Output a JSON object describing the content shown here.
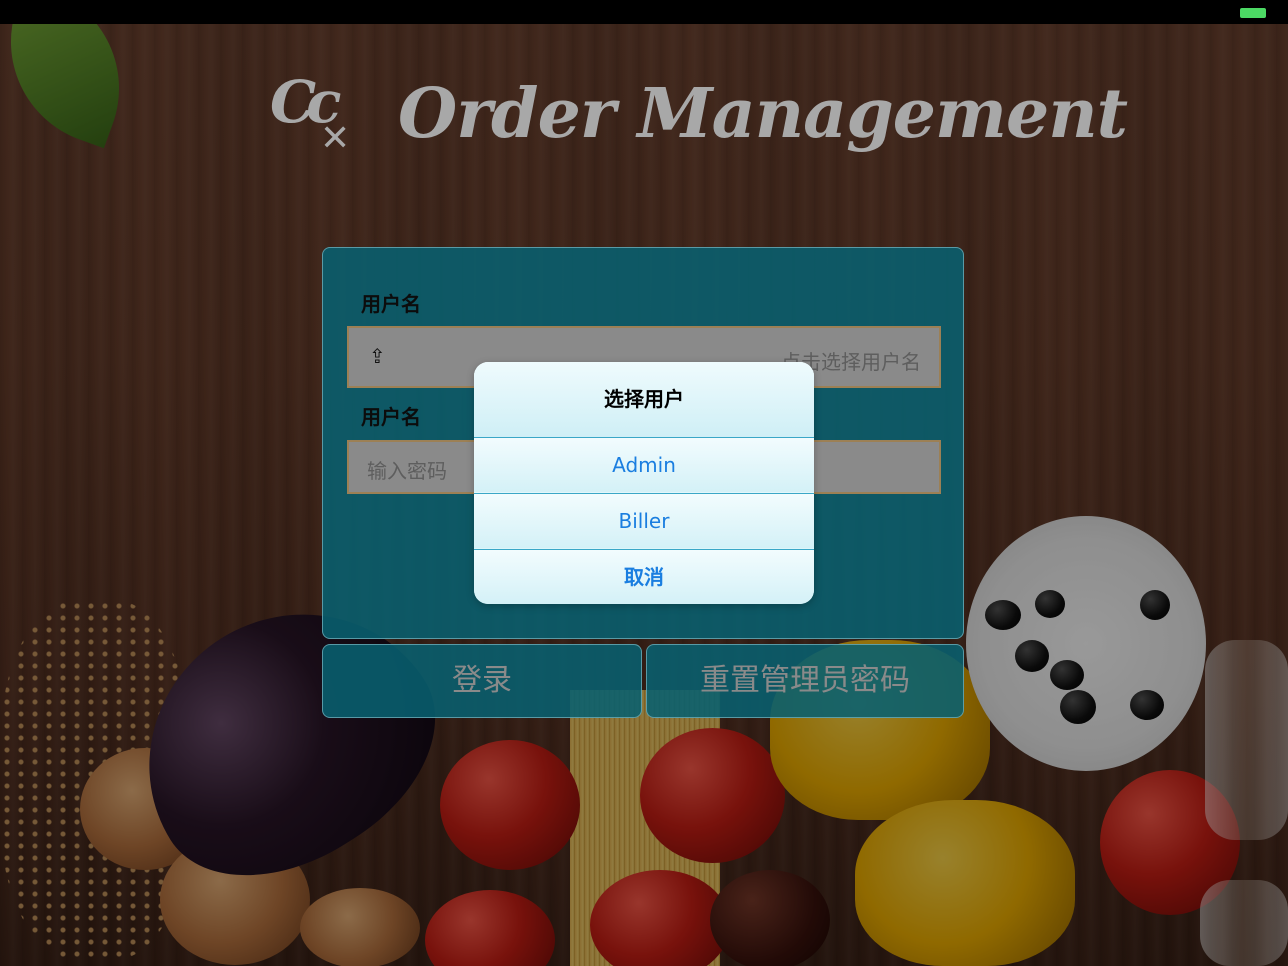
{
  "app": {
    "logo_mark": "Cc",
    "title": "Order Management"
  },
  "status_bar": {
    "battery_color": "#4cd964"
  },
  "login": {
    "username_label": "用户名",
    "username_placeholder": "点击选择用户名",
    "username_icon": "arrow-up-icon",
    "password_label": "用户名",
    "password_placeholder": "输入密码",
    "login_button": "登录",
    "reset_button": "重置管理员密码"
  },
  "user_picker": {
    "title": "选择用户",
    "options": [
      "Admin",
      "Biller"
    ],
    "cancel": "取消"
  },
  "colors": {
    "card_bg": "#086070",
    "sheet_text": "#1a7ee0",
    "logo_gray": "#a8a8a8"
  }
}
